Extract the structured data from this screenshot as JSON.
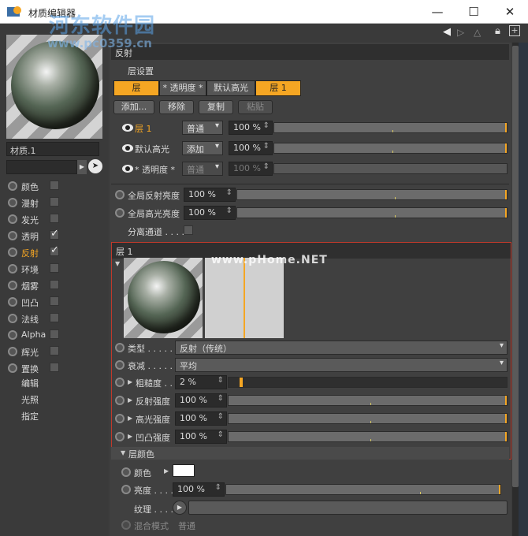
{
  "window": {
    "title": "材质编辑器",
    "minimize": "—",
    "maximize": "☐",
    "close": "✕"
  },
  "watermark": {
    "site_cn": "河东软件园",
    "site_url": "www.pc0359.cn",
    "overlay": "www.pHome.NET"
  },
  "left": {
    "material_name": "材质.1",
    "channels": [
      {
        "label": "颜色",
        "checked": false,
        "active": false
      },
      {
        "label": "漫射",
        "checked": false,
        "active": false
      },
      {
        "label": "发光",
        "checked": false,
        "active": false
      },
      {
        "label": "透明",
        "checked": true,
        "active": false
      },
      {
        "label": "反射",
        "checked": true,
        "active": true
      },
      {
        "label": "环境",
        "checked": false,
        "active": false
      },
      {
        "label": "烟雾",
        "checked": false,
        "active": false
      },
      {
        "label": "凹凸",
        "checked": false,
        "active": false
      },
      {
        "label": "法线",
        "checked": false,
        "active": false
      },
      {
        "label": "Alpha",
        "checked": false,
        "active": false
      },
      {
        "label": "辉光",
        "checked": false,
        "active": false
      },
      {
        "label": "置换",
        "checked": false,
        "active": false
      }
    ],
    "sub_items": [
      "编辑",
      "光照",
      "指定"
    ]
  },
  "right": {
    "section_title": "反射",
    "layer_settings_label": "层设置",
    "tabs": [
      "层",
      "* 透明度 *",
      "默认高光",
      "层 1"
    ],
    "buttons": {
      "add": "添加...",
      "remove": "移除",
      "copy": "复制",
      "paste": "粘贴"
    },
    "layers": [
      {
        "name": "层 1",
        "mode": "普通",
        "value": "100 %",
        "active": true,
        "disabled": false
      },
      {
        "name": "默认高光",
        "mode": "添加",
        "value": "100 %",
        "active": false,
        "disabled": false
      },
      {
        "name": "* 透明度 *",
        "mode": "普通",
        "value": "100 %",
        "active": false,
        "disabled": true
      }
    ],
    "global_refl_label": "全局反射亮度",
    "global_refl_value": "100 %",
    "global_spec_label": "全局高光亮度",
    "global_spec_value": "100 %",
    "separate_pass_label": "分离通道 . . . .",
    "layer_section_title": "层 1",
    "type_label": "类型 . . . . .",
    "type_value": "反射（传统）",
    "atten_label": "衰减 . . . . .",
    "atten_value": "平均",
    "rough_label": "粗糙度 . .",
    "rough_value": "2 %",
    "rough_level": 0.02,
    "refl_str_label": "反射强度",
    "refl_str_value": "100 %",
    "spec_str_label": "高光强度",
    "spec_str_value": "100 %",
    "bump_str_label": "凹凸强度",
    "bump_str_value": "100 %",
    "layer_color_title": "层颜色",
    "color_label": "颜色",
    "color_value": "#ffffff",
    "bright_label": "亮度 . . . .",
    "bright_value": "100 %",
    "texture_label": "纹理 . . . .",
    "blend_label": "混合模式",
    "blend_value": "普通"
  },
  "colors": {
    "accent": "#f5a623",
    "panel": "#404040"
  }
}
